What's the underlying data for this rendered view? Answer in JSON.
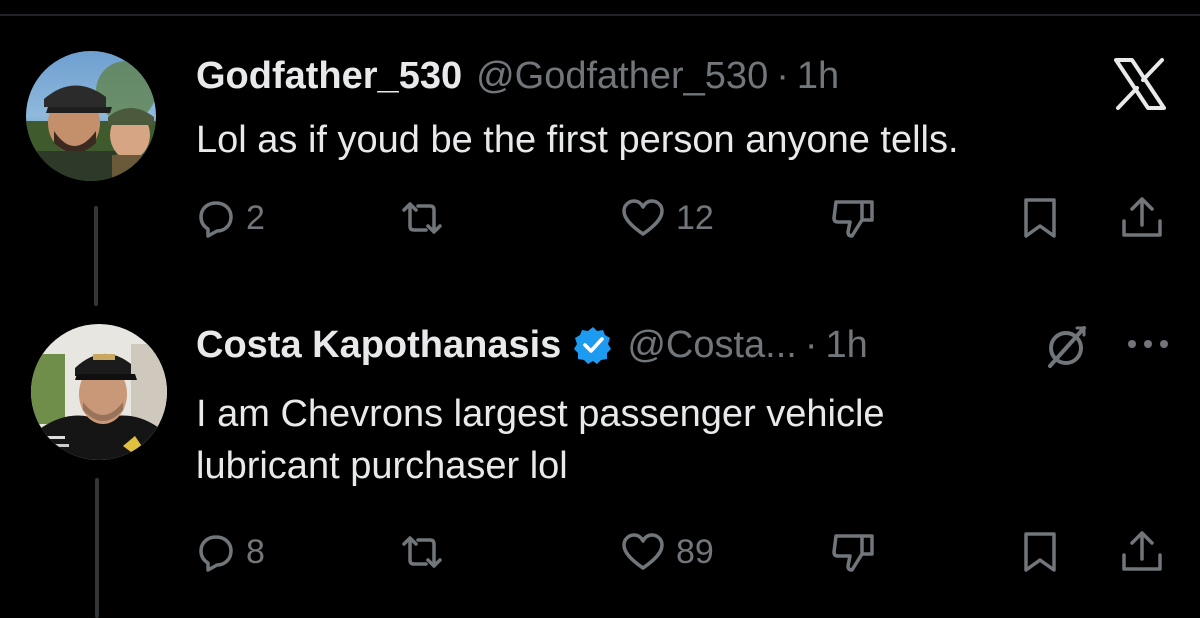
{
  "tweets": [
    {
      "display_name": "Godfather_530",
      "handle": "@Godfather_530",
      "separator": "·",
      "time": "1h",
      "text_lines": [
        "Lol as if youd be the first person anyone tells."
      ],
      "verified": false,
      "top_right_icon": "x-logo-icon",
      "replies": "2",
      "reposts": "",
      "likes": "12"
    },
    {
      "display_name": "Costa Kapothanasis",
      "handle": "@Costa...",
      "separator": "·",
      "time": "1h",
      "text_lines": [
        "I am Chevrons largest passenger vehicle",
        "lubricant purchaser lol"
      ],
      "verified": true,
      "top_right_icons": [
        "grok-icon",
        "more-icon"
      ],
      "replies": "8",
      "reposts": "",
      "likes": "89"
    }
  ],
  "colors": {
    "background": "#000000",
    "text": "#e7e9ea",
    "muted": "#71767b",
    "verified": "#1d9bf0",
    "thread_line": "#333639"
  }
}
